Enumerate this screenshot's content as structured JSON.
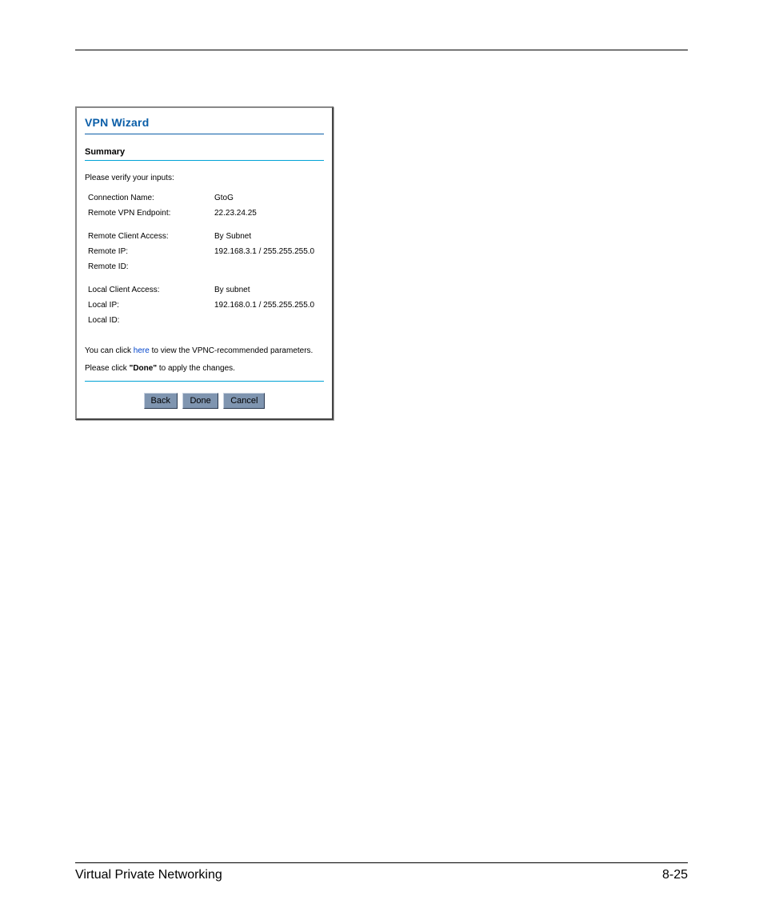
{
  "wizard": {
    "title": "VPN Wizard",
    "section": "Summary",
    "verify_text": "Please verify your inputs:",
    "group1": [
      {
        "label": "Connection Name:",
        "value": "GtoG"
      },
      {
        "label": "Remote VPN Endpoint:",
        "value": "22.23.24.25"
      }
    ],
    "group2": [
      {
        "label": "Remote Client Access:",
        "value": "By Subnet"
      },
      {
        "label": "Remote IP:",
        "value": "192.168.3.1 / 255.255.255.0"
      },
      {
        "label": "Remote ID:",
        "value": ""
      }
    ],
    "group3": [
      {
        "label": "Local Client Access:",
        "value": "By subnet"
      },
      {
        "label": "Local IP:",
        "value": "192.168.0.1 / 255.255.255.0"
      },
      {
        "label": "Local ID:",
        "value": ""
      }
    ],
    "note_pre": "You can click ",
    "note_link": "here",
    "note_post": " to view the VPNC-recommended parameters.",
    "apply_pre": "Please click ",
    "apply_bold": "\"Done\"",
    "apply_post": " to apply the changes.",
    "buttons": {
      "back": "Back",
      "done": "Done",
      "cancel": "Cancel"
    }
  },
  "footer": {
    "left": "Virtual Private Networking",
    "right": "8-25"
  }
}
